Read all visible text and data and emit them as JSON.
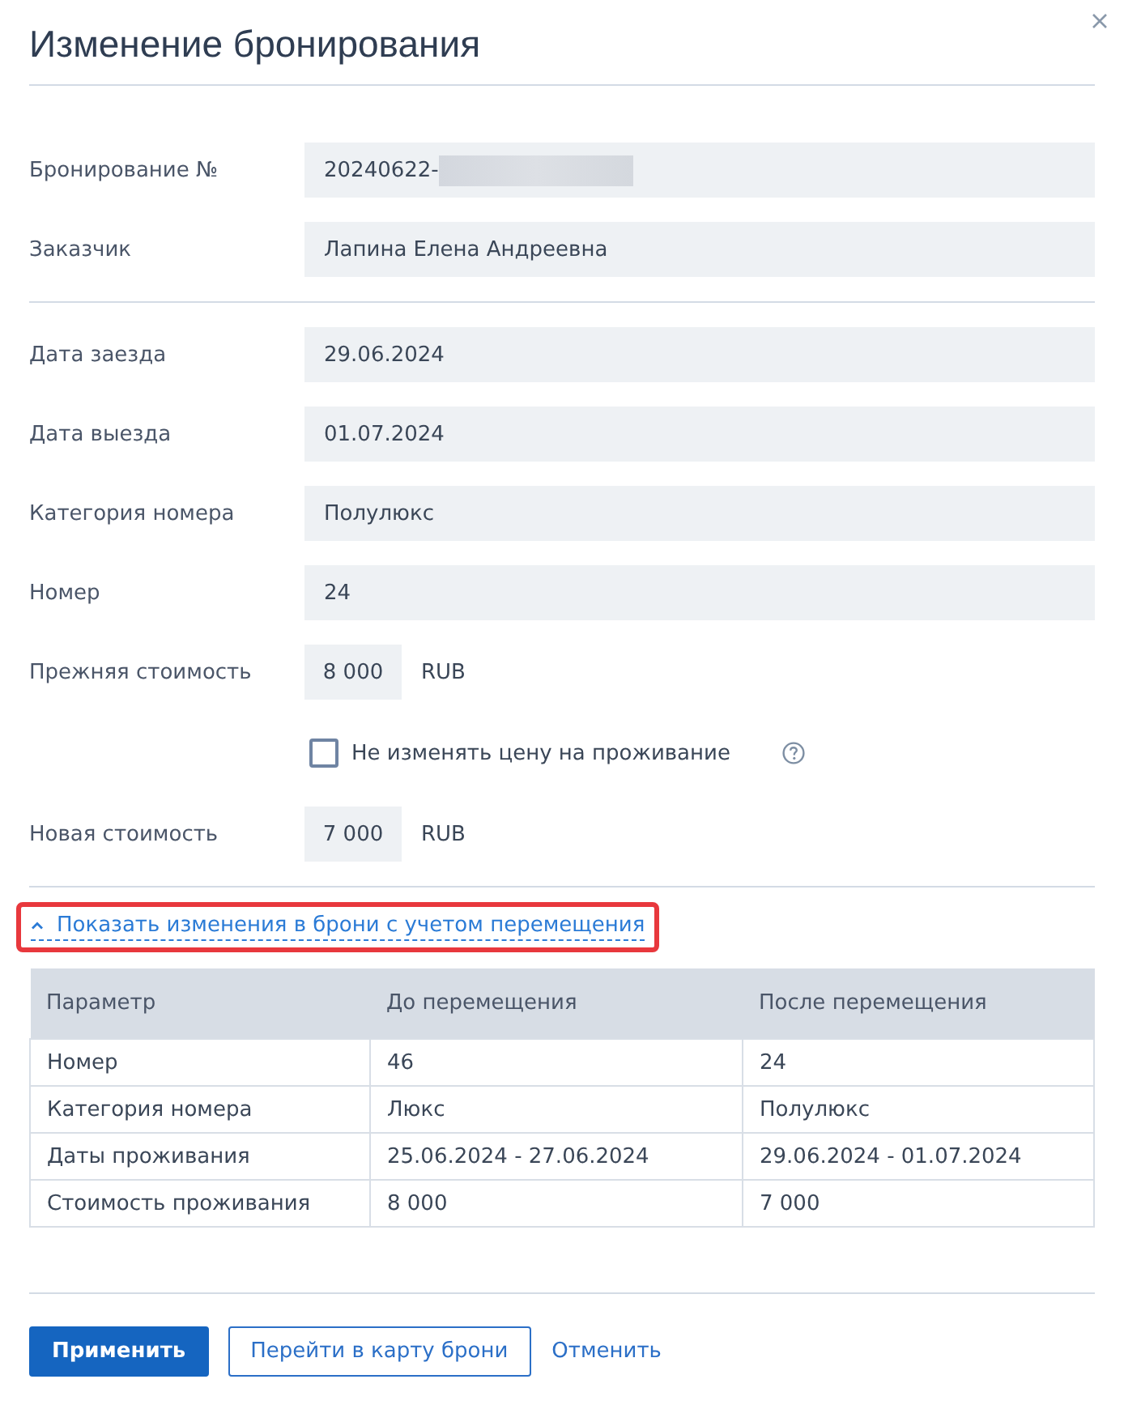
{
  "dialog": {
    "title": "Изменение бронирования"
  },
  "booking_section": [
    {
      "kind": "text",
      "label": "Бронирование №",
      "value": "20240622-",
      "redacted": true
    },
    {
      "kind": "text",
      "label": "Заказчик",
      "value": "Лапина Елена Андреевна",
      "redacted": false
    }
  ],
  "stay_section": [
    {
      "kind": "text",
      "label": "Дата заезда",
      "value": "29.06.2024"
    },
    {
      "kind": "text",
      "label": "Дата выезда",
      "value": "01.07.2024"
    },
    {
      "kind": "text",
      "label": "Категория номера",
      "value": "Полулюкс"
    },
    {
      "kind": "text",
      "label": "Номер",
      "value": "24"
    },
    {
      "kind": "price",
      "label": "Прежняя стоимость",
      "value": "8 000",
      "currency": "RUB"
    },
    {
      "kind": "checkbox",
      "label": "Не изменять цену на проживание",
      "checked": false
    },
    {
      "kind": "price",
      "label": "Новая стоимость",
      "value": "7 000",
      "currency": "RUB"
    }
  ],
  "changes_toggle": {
    "label": "Показать изменения в брони с учетом перемещения",
    "expanded": true,
    "highlighted": true
  },
  "changes_table": {
    "columns": [
      "Параметр",
      "До перемещения",
      "После перемещения"
    ],
    "rows": [
      [
        "Номер",
        "46",
        "24"
      ],
      [
        "Категория номера",
        "Люкс",
        "Полулюкс"
      ],
      [
        "Даты проживания",
        "25.06.2024 - 27.06.2024",
        "29.06.2024 - 01.07.2024"
      ],
      [
        "Стоимость проживания",
        "8 000",
        "7 000"
      ]
    ]
  },
  "buttons": [
    {
      "kind": "primary",
      "label": "Применить"
    },
    {
      "kind": "outline",
      "label": "Перейти в карту брони"
    },
    {
      "kind": "link",
      "label": "Отменить"
    }
  ]
}
